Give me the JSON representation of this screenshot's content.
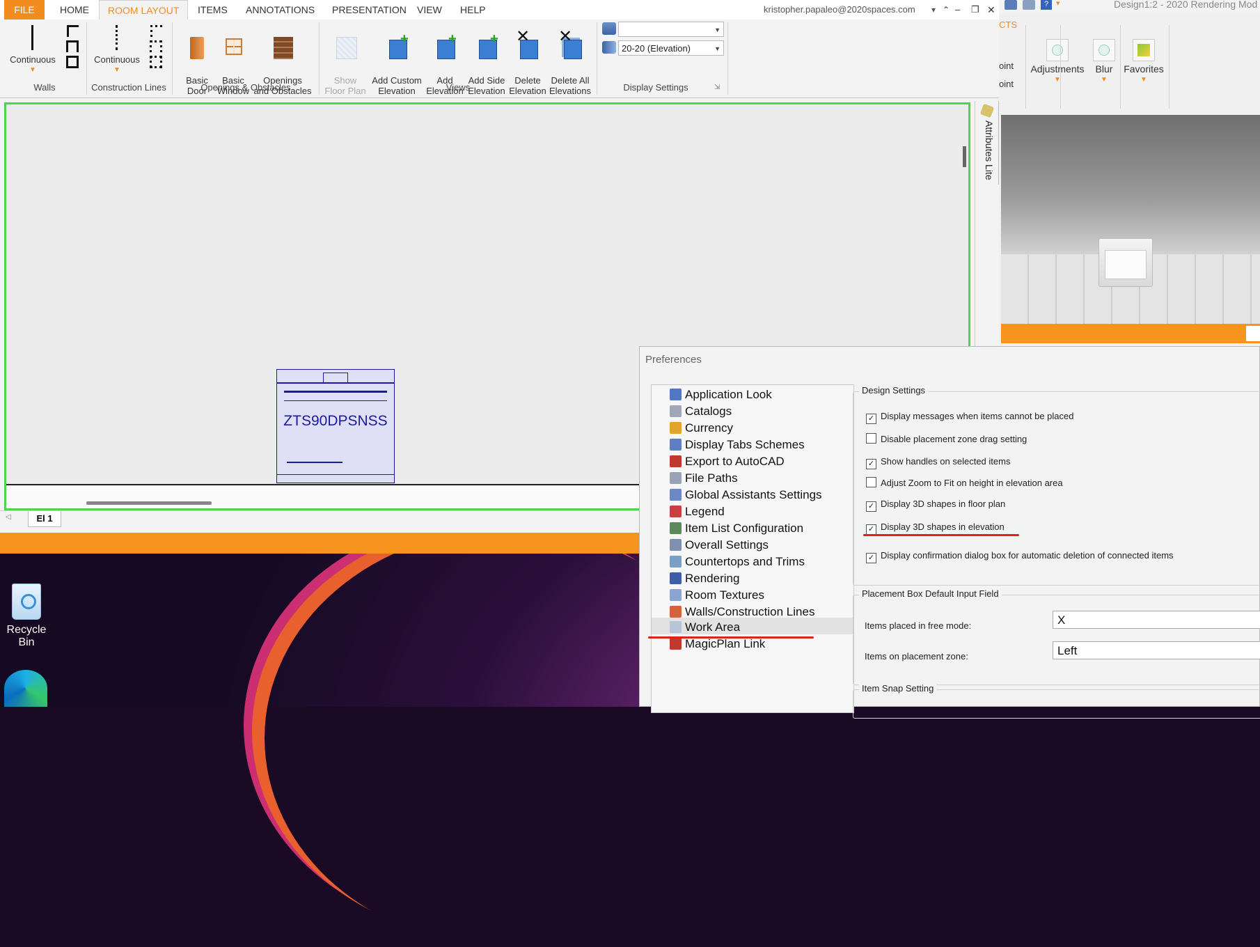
{
  "desktop": {
    "recycle_bin": "Recycle Bin"
  },
  "tabs": [
    "FILE",
    "HOME",
    "ROOM LAYOUT",
    "ITEMS",
    "ANNOTATIONS",
    "PRESENTATION",
    "VIEW",
    "HELP"
  ],
  "account": "kristopher.papaleo@2020spaces.com",
  "ribbon": {
    "walls_btn": "Continuous",
    "walls_group": "Walls",
    "constr_btn": "Continuous",
    "constr_group": "Construction Lines",
    "basic_door": "Basic\nDoor",
    "basic_window": "Basic\nWindow",
    "openings": "Openings\nand Obstacles",
    "openings_group": "Openings & Obstacles",
    "show_floor_plan": "Show\nFloor Plan",
    "add_custom_elev": "Add Custom\nElevation",
    "add_elev": "Add\nElevation",
    "add_side_elev": "Add Side\nElevation",
    "delete_elev": "Delete\nElevation",
    "delete_all_elev": "Delete All\nElevations",
    "views_group": "Views",
    "display_dd1": "",
    "display_dd2": "20-20 (Elevation)",
    "display_group": "Display Settings"
  },
  "canvas": {
    "item_label": "ZTS90DPSNSS",
    "tab_label": "El 1",
    "side_label": "Attributes Lite"
  },
  "render_panel": {
    "title": "Design1:2 - 2020 Rendering Mod",
    "partial_tab": "CTS",
    "partial_1": "oint",
    "partial_2": "oint",
    "adjustments": "Adjustments",
    "blur": "Blur",
    "favorites": "Favorites"
  },
  "preferences": {
    "title": "Preferences",
    "categories": [
      "Application Look",
      "Catalogs",
      "Currency",
      "Display Tabs Schemes",
      "Export to AutoCAD",
      "File Paths",
      "Global Assistants Settings",
      "Legend",
      "Item List Configuration",
      "Overall Settings",
      "Countertops and Trims",
      "Rendering",
      "Room Textures",
      "Walls/Construction Lines",
      "Work Area",
      "MagicPlan Link"
    ],
    "selected": "Work Area",
    "design_settings": "Design Settings",
    "options": [
      {
        "label": "Display messages when items cannot be placed",
        "checked": true
      },
      {
        "label": "Disable placement zone drag setting",
        "checked": false
      },
      {
        "label": "Show handles on selected items",
        "checked": true
      },
      {
        "label": "Adjust Zoom to Fit on height in elevation area",
        "checked": false
      },
      {
        "label": "Display 3D shapes in floor plan",
        "checked": true
      },
      {
        "label": "Display 3D shapes in elevation",
        "checked": true
      },
      {
        "label": "Display confirmation dialog box for automatic deletion of connected items",
        "checked": true
      }
    ],
    "placement_box": "Placement Box Default Input Field",
    "free_mode_label": "Items placed in free mode:",
    "free_mode_value": "X",
    "zone_label": "Items on placement zone:",
    "zone_value": "Left",
    "snap": "Item Snap Setting"
  },
  "colors": {
    "accent": "#f28c1e",
    "orange_bar": "#f7941d",
    "green_frame": "#4ed44e",
    "annotation": "#e0201c",
    "drawing": "#1a1aa0"
  }
}
